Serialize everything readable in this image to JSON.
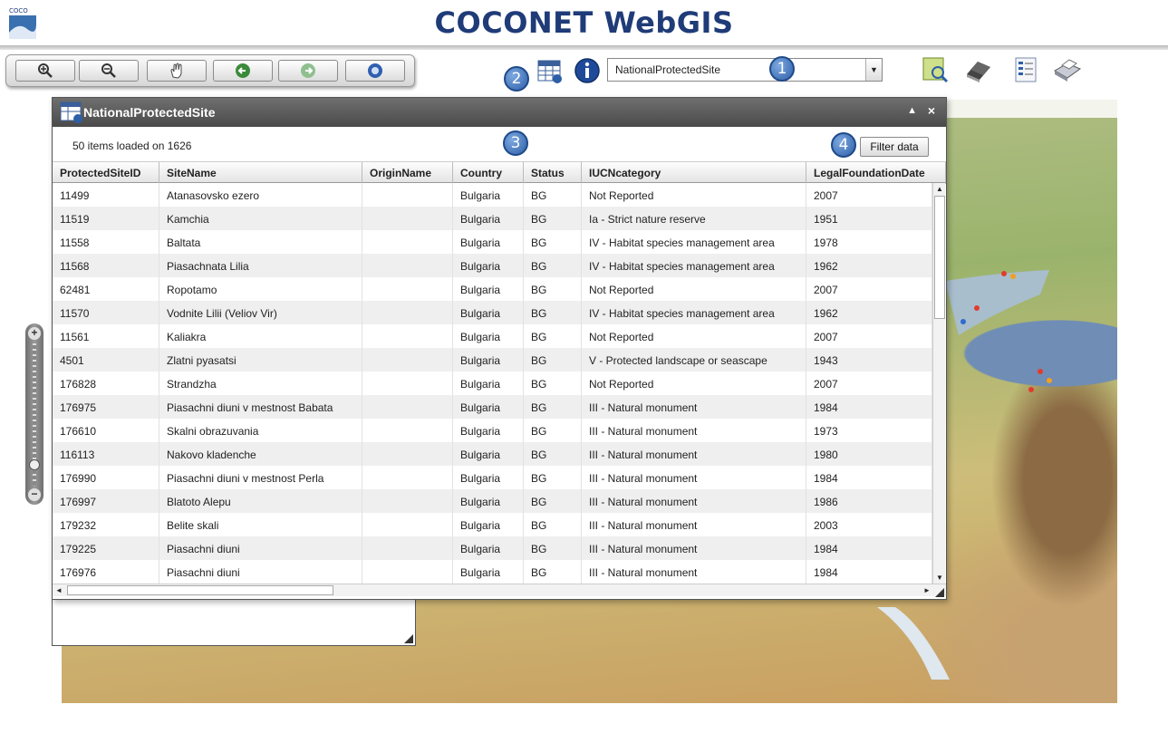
{
  "header": {
    "title": "COCONET WebGIS",
    "logo_text": "COCO"
  },
  "toolbar": {
    "nav_buttons": [
      {
        "icon": "zoom-in-icon"
      },
      {
        "icon": "zoom-out-icon"
      },
      {
        "icon": "pan-hand-icon"
      },
      {
        "icon": "back-arrow-icon"
      },
      {
        "icon": "forward-arrow-icon"
      },
      {
        "icon": "full-extent-icon"
      }
    ],
    "annotations": [
      "1",
      "2",
      "3",
      "4"
    ],
    "layer_select_value": "NationalProtectedSite",
    "tools": [
      "identify-tool-icon",
      "eraser-icon",
      "legend-icon",
      "print-icon"
    ]
  },
  "attribute_window": {
    "title": "NationalProtectedSite",
    "items_loaded": "50 items loaded on 1626",
    "filter_button": "Filter data",
    "columns": [
      "ProtectedSiteID",
      "SiteName",
      "OriginName",
      "Country",
      "Status",
      "IUCNcategory",
      "LegalFoundationDate"
    ],
    "rows": [
      [
        "11499",
        "Atanasovsko ezero",
        "",
        "Bulgaria",
        "BG",
        "Not Reported",
        "2007"
      ],
      [
        "11519",
        "Kamchia",
        "",
        "Bulgaria",
        "BG",
        "Ia - Strict nature reserve",
        "1951"
      ],
      [
        "11558",
        "Baltata",
        "",
        "Bulgaria",
        "BG",
        "IV - Habitat species management area",
        "1978"
      ],
      [
        "11568",
        "Piasachnata Lilia",
        "",
        "Bulgaria",
        "BG",
        "IV - Habitat species management area",
        "1962"
      ],
      [
        "62481",
        "Ropotamo",
        "",
        "Bulgaria",
        "BG",
        "Not Reported",
        "2007"
      ],
      [
        "11570",
        "Vodnite Lilii (Veliov Vir)",
        "",
        "Bulgaria",
        "BG",
        "IV - Habitat species management area",
        "1962"
      ],
      [
        "11561",
        "Kaliakra",
        "",
        "Bulgaria",
        "BG",
        "Not Reported",
        "2007"
      ],
      [
        "4501",
        "Zlatni pyasatsi",
        "",
        "Bulgaria",
        "BG",
        "V - Protected landscape or seascape",
        "1943"
      ],
      [
        "176828",
        "Strandzha",
        "",
        "Bulgaria",
        "BG",
        "Not Reported",
        "2007"
      ],
      [
        "176975",
        "Piasachni diuni v mestnost Babata",
        "",
        "Bulgaria",
        "BG",
        "III - Natural monument",
        "1984"
      ],
      [
        "176610",
        "Skalni obrazuvania",
        "",
        "Bulgaria",
        "BG",
        "III - Natural monument",
        "1973"
      ],
      [
        "116113",
        "Nakovo kladenche",
        "",
        "Bulgaria",
        "BG",
        "III - Natural monument",
        "1980"
      ],
      [
        "176990",
        "Piasachni diuni v mestnost Perla",
        "",
        "Bulgaria",
        "BG",
        "III - Natural monument",
        "1984"
      ],
      [
        "176997",
        "Blatoto Alepu",
        "",
        "Bulgaria",
        "BG",
        "III - Natural monument",
        "1986"
      ],
      [
        "179232",
        "Belite skali",
        "",
        "Bulgaria",
        "BG",
        "III - Natural monument",
        "2003"
      ],
      [
        "179225",
        "Piasachni diuni",
        "",
        "Bulgaria",
        "BG",
        "III - Natural monument",
        "1984"
      ],
      [
        "176976",
        "Piasachni diuni",
        "",
        "Bulgaria",
        "BG",
        "III - Natural monument",
        "1984"
      ]
    ]
  },
  "zoom": {
    "plus": "+",
    "minus": "−"
  },
  "colors": {
    "title": "#1f3b78",
    "annotation": "#2d5fa8",
    "titlebar": "#5a5a5a"
  }
}
